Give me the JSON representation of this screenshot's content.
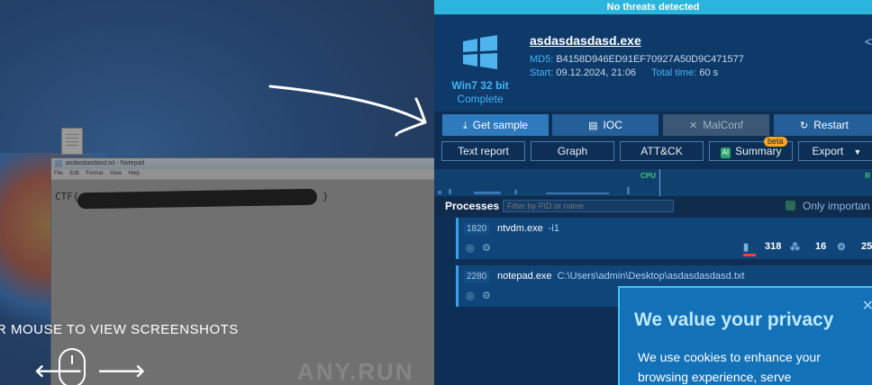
{
  "left_preview": {
    "notepad_title": "asdasdasdasd.txt - Notepad",
    "notepad_menu": [
      "File",
      "Edit",
      "Format",
      "View",
      "Help"
    ],
    "notepad_text_start": "CTF{",
    "notepad_text_end": "}",
    "hover_hint": "R MOUSE TO VIEW SCREENSHOTS",
    "prev_arrow": "🡐",
    "next_arrow": "🡒",
    "watermark": "ANY.RUN"
  },
  "panel": {
    "threat_status": "No threats detected",
    "os_name": "Win7 32 bit",
    "os_status": "Complete",
    "filename": "asdasdasdasd.exe",
    "md5_label": "MD5:",
    "md5": "B4158D946ED91EF70927A50D9C471577",
    "start_label": "Start:",
    "start": "09.12.2024, 21:06",
    "total_label": "Total time:",
    "total": "60 s"
  },
  "actions": {
    "get_sample": "Get sample",
    "ioc": "IOC",
    "malconf": "MalConf",
    "restart": "Restart",
    "text_report": "Text report",
    "graph": "Graph",
    "attck": "ATT&CK",
    "ai_badge": "AI",
    "summary": "Summary",
    "beta": "beta",
    "export": "Export"
  },
  "monitor": {
    "cpu_label": "CPU",
    "r_label": "R"
  },
  "processes": {
    "title": "Processes",
    "filter_placeholder": "Filter by PID or name",
    "only_important": "Only importan",
    "items": [
      {
        "pid": "1820",
        "name": "ntvdm.exe",
        "args": "-i1",
        "files": "318",
        "modules": "16",
        "registry": "25"
      },
      {
        "pid": "2280",
        "name": "notepad.exe",
        "args": "C:\\Users\\admin\\Desktop\\asdasdasdasd.txt"
      }
    ]
  },
  "privacy": {
    "title": "We value your privacy",
    "text": "We use cookies to enhance your browsing experience, serve",
    "close": "✕"
  },
  "colors": {
    "accent": "#2bb5dd",
    "link": "#44b3f4",
    "panel_bg": "#0e2f55"
  }
}
